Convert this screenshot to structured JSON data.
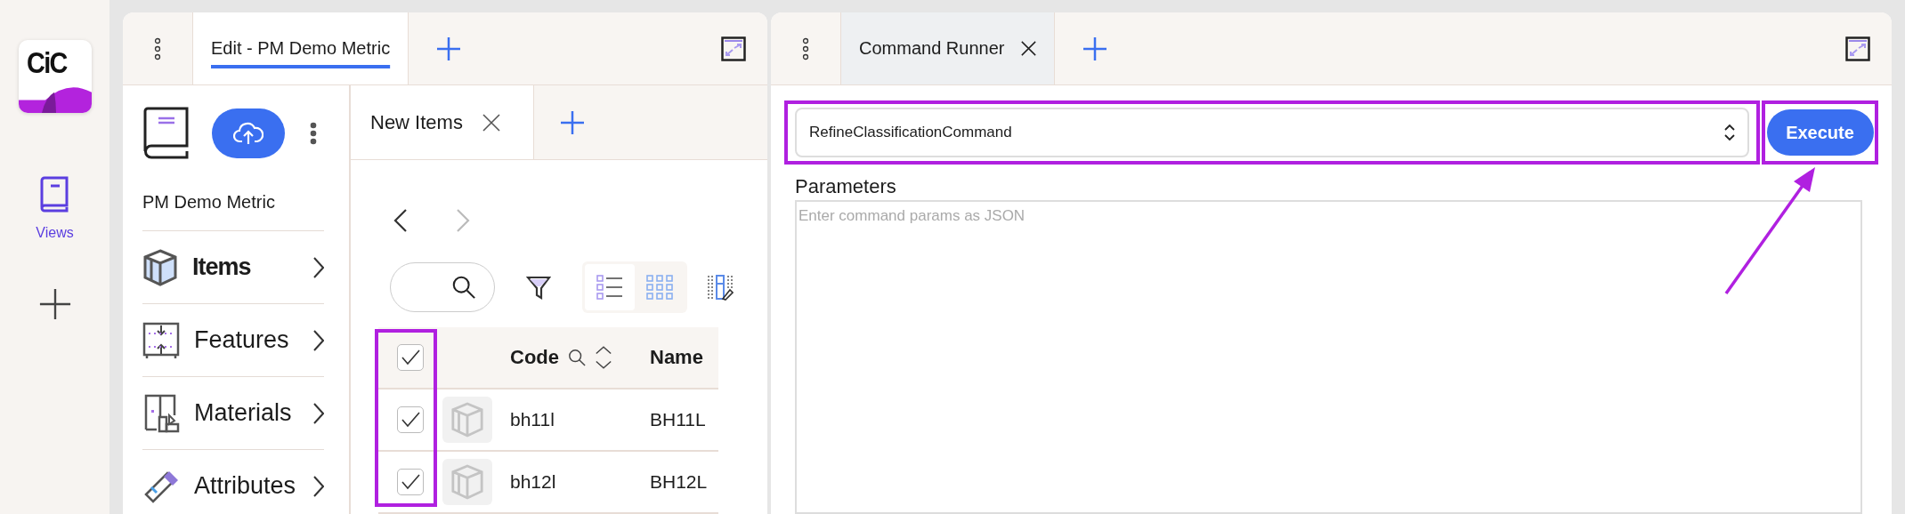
{
  "rail": {
    "logo": "CiC",
    "items": [
      {
        "label": "Views",
        "selected": true
      }
    ]
  },
  "left_panel": {
    "tabs": [
      {
        "label": "Edit - PM Demo Metric",
        "selected": true,
        "closable": false
      }
    ],
    "sidebar": {
      "title": "PM Demo Metric",
      "items": [
        {
          "label": "Items",
          "kind": "cube",
          "selected": true
        },
        {
          "label": "Features",
          "kind": "features",
          "selected": false
        },
        {
          "label": "Materials",
          "kind": "materials",
          "selected": false
        },
        {
          "label": "Attributes",
          "kind": "attributes",
          "selected": false
        }
      ]
    },
    "inner_panel": {
      "tabs": [
        {
          "label": "New Items",
          "selected": true,
          "closable": true
        }
      ],
      "nav": {
        "back_disabled": false,
        "forward_disabled": true
      },
      "view_modes": [
        {
          "kind": "list",
          "selected": true
        },
        {
          "kind": "grid",
          "selected": false
        }
      ],
      "table": {
        "header_checked": true,
        "columns": [
          {
            "label": "Code",
            "searchable": true,
            "sortable": true
          },
          {
            "label": "Name",
            "searchable": false,
            "sortable": false
          }
        ],
        "rows": [
          {
            "checked": true,
            "code": "bh11l",
            "name": "BH11L"
          },
          {
            "checked": true,
            "code": "bh12l",
            "name": "BH12L"
          }
        ]
      }
    }
  },
  "right_panel": {
    "tabs": [
      {
        "label": "Command Runner",
        "selected": true,
        "closable": true
      }
    ],
    "command": {
      "value": "RefineClassificationCommand"
    },
    "execute": "Execute",
    "parameters": {
      "label": "Parameters",
      "placeholder": "Enter command params as JSON"
    }
  }
}
